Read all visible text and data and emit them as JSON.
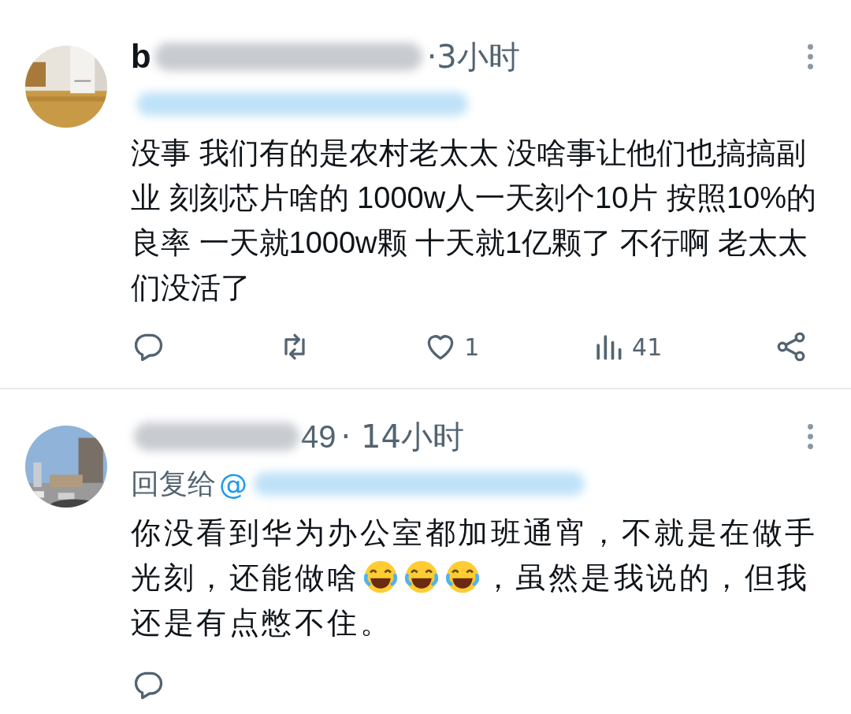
{
  "tweets": [
    {
      "name_visible": "b",
      "time": "·3小时",
      "has_reply_to": false,
      "avatar": {
        "kind": "picture"
      },
      "segments": [
        {
          "kind": "text",
          "text": "没事 我们有的是农村老太太 没啥事让他们也搞搞副业 刻刻芯片啥的 1000w人一天刻个10片 按照10%的良率 一天就1000w颗 十天就1亿颗了 不行啊 老太太们没活了"
        }
      ],
      "actions": [
        {
          "kind": "reply"
        },
        {
          "kind": "retweet"
        },
        {
          "kind": "like",
          "count": "1"
        },
        {
          "kind": "views",
          "count": "41"
        },
        {
          "kind": "share"
        }
      ]
    },
    {
      "name_visible": "49",
      "time": "· 14小时",
      "has_reply_to": true,
      "reply_label": "回复给",
      "reply_at": "@",
      "avatar": {
        "kind": "picture"
      },
      "segments": [
        {
          "kind": "text",
          "text": "你没看到华为办公室都加班通宵，不就是在做手光刻，还能做啥"
        },
        {
          "kind": "emoji"
        },
        {
          "kind": "emoji"
        },
        {
          "kind": "emoji"
        },
        {
          "kind": "text",
          "text": "，虽然是我说的，但我还是有点憋不住。"
        }
      ],
      "actions": [
        {
          "kind": "reply"
        }
      ]
    }
  ]
}
